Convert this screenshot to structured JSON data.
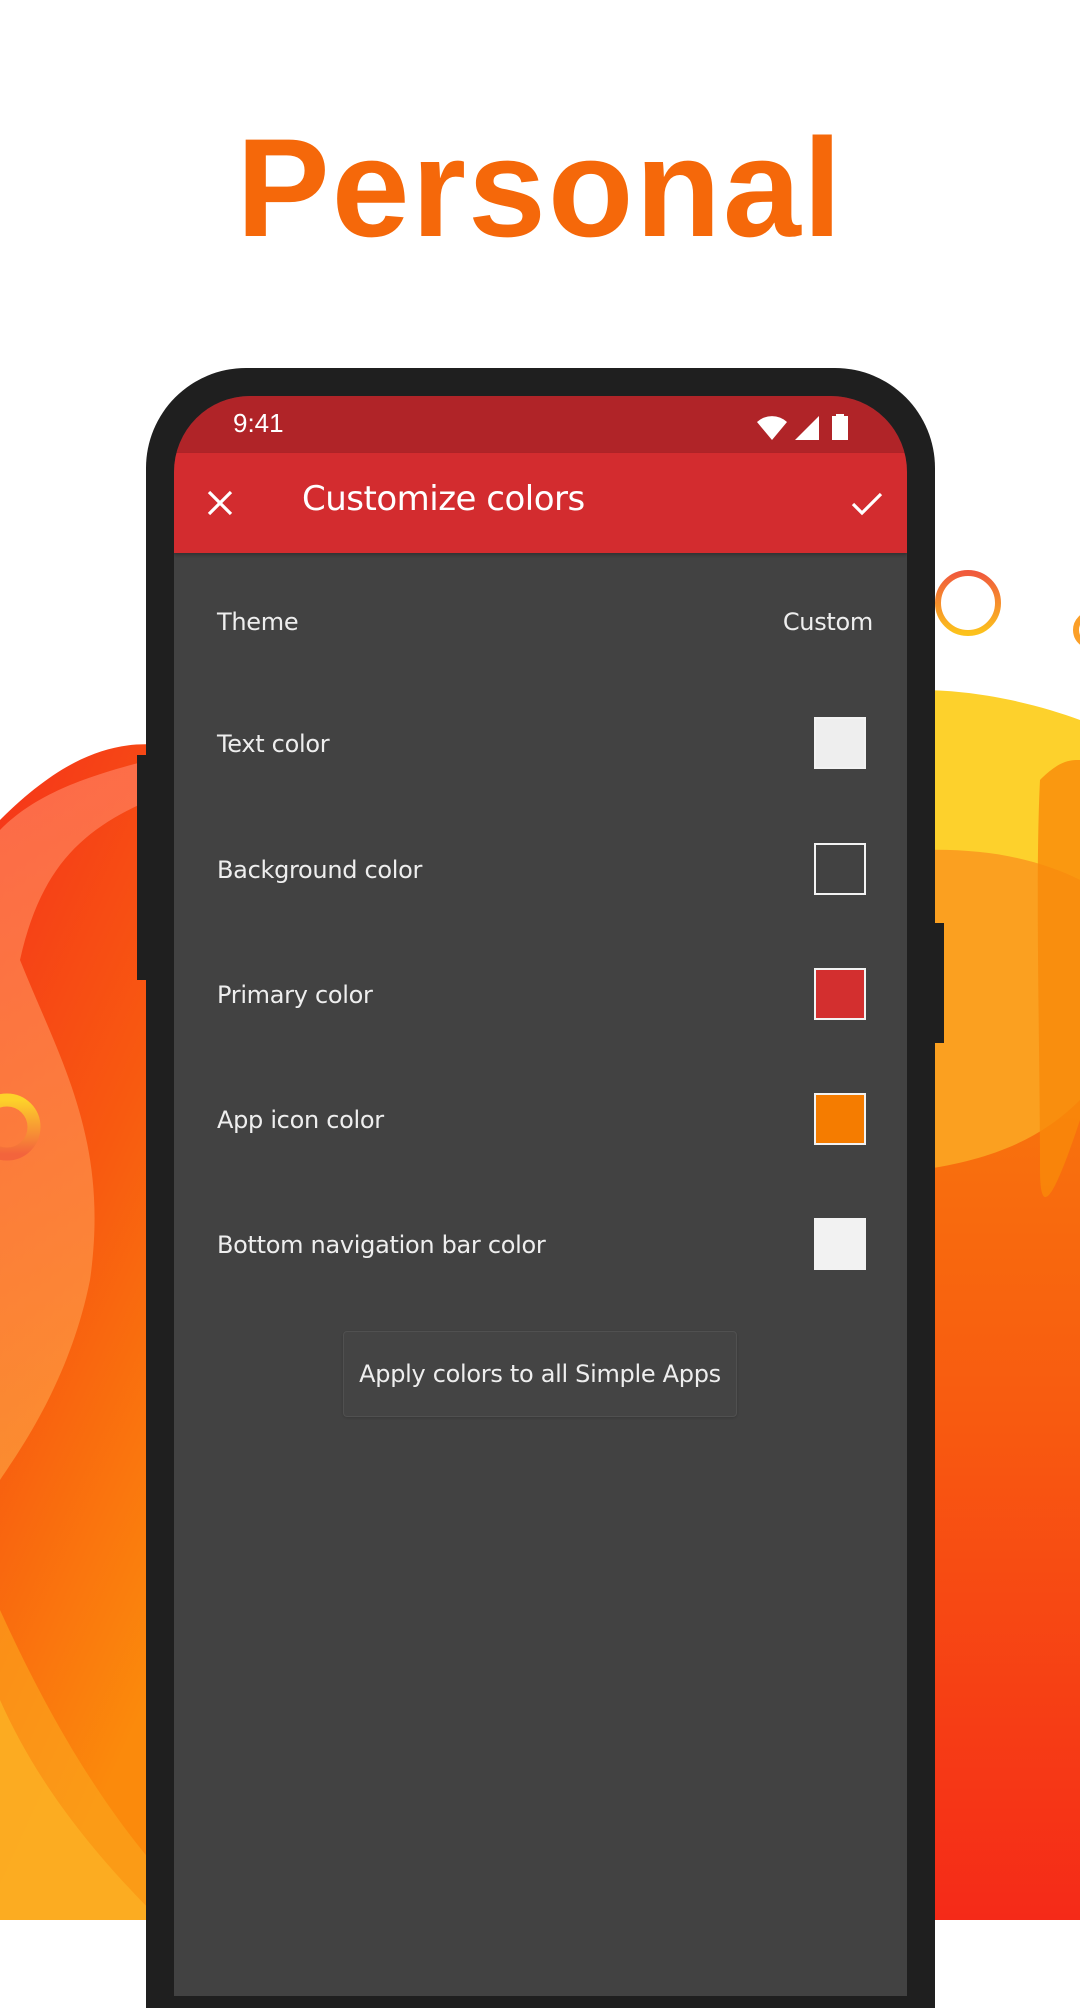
{
  "headline": "Personal",
  "colors": {
    "headline": "#f5680a",
    "status_bar": "#b02428",
    "toolbar": "#d32c2f",
    "screen_bg": "#424242",
    "frame": "#1f1f1f"
  },
  "status_bar": {
    "time": "9:41",
    "icons": [
      "wifi-icon",
      "cell-signal-icon",
      "battery-icon"
    ]
  },
  "toolbar": {
    "close_icon": "close-icon",
    "title": "Customize colors",
    "confirm_icon": "check-icon"
  },
  "settings": [
    {
      "label": "Theme",
      "value": "Custom"
    },
    {
      "label": "Text color",
      "swatch": "#eeeeee"
    },
    {
      "label": "Background color",
      "swatch": "#424242"
    },
    {
      "label": "Primary color",
      "swatch": "#d32f2f"
    },
    {
      "label": "App icon color",
      "swatch": "#f57c00"
    },
    {
      "label": "Bottom navigation bar color",
      "swatch": "#f2f2f2"
    }
  ],
  "apply_button": "Apply colors to all Simple Apps"
}
